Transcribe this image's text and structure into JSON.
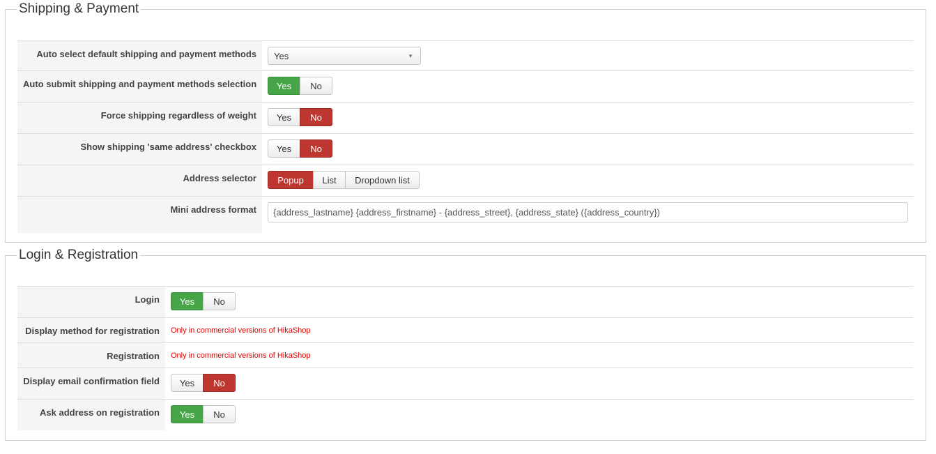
{
  "shipping_payment": {
    "legend": "Shipping & Payment",
    "auto_select": {
      "label": "Auto select default shipping and payment methods",
      "value": "Yes"
    },
    "auto_submit": {
      "label": "Auto submit shipping and payment methods selection",
      "yes": "Yes",
      "no": "No",
      "selected": "Yes"
    },
    "force_shipping": {
      "label": "Force shipping regardless of weight",
      "yes": "Yes",
      "no": "No",
      "selected": "No"
    },
    "same_address": {
      "label": "Show shipping 'same address' checkbox",
      "yes": "Yes",
      "no": "No",
      "selected": "No"
    },
    "address_selector": {
      "label": "Address selector",
      "options": [
        "Popup",
        "List",
        "Dropdown list"
      ],
      "selected": "Popup"
    },
    "mini_address": {
      "label": "Mini address format",
      "value": "{address_lastname} {address_firstname} - {address_street}, {address_state} ({address_country})"
    }
  },
  "login_registration": {
    "legend": "Login & Registration",
    "login": {
      "label": "Login",
      "yes": "Yes",
      "no": "No",
      "selected": "Yes"
    },
    "display_method": {
      "label": "Display method for registration",
      "note": "Only in commercial versions of HikaShop"
    },
    "registration": {
      "label": "Registration",
      "note": "Only in commercial versions of HikaShop"
    },
    "email_confirm": {
      "label": "Display email confirmation field",
      "yes": "Yes",
      "no": "No",
      "selected": "No"
    },
    "ask_address": {
      "label": "Ask address on registration",
      "yes": "Yes",
      "no": "No",
      "selected": "Yes"
    }
  },
  "colors": {
    "yes_active": "#46a546",
    "no_active": "#bd362f",
    "commercial_note": "#e00000"
  },
  "icons": {
    "select_caret": "caret-down-icon"
  }
}
